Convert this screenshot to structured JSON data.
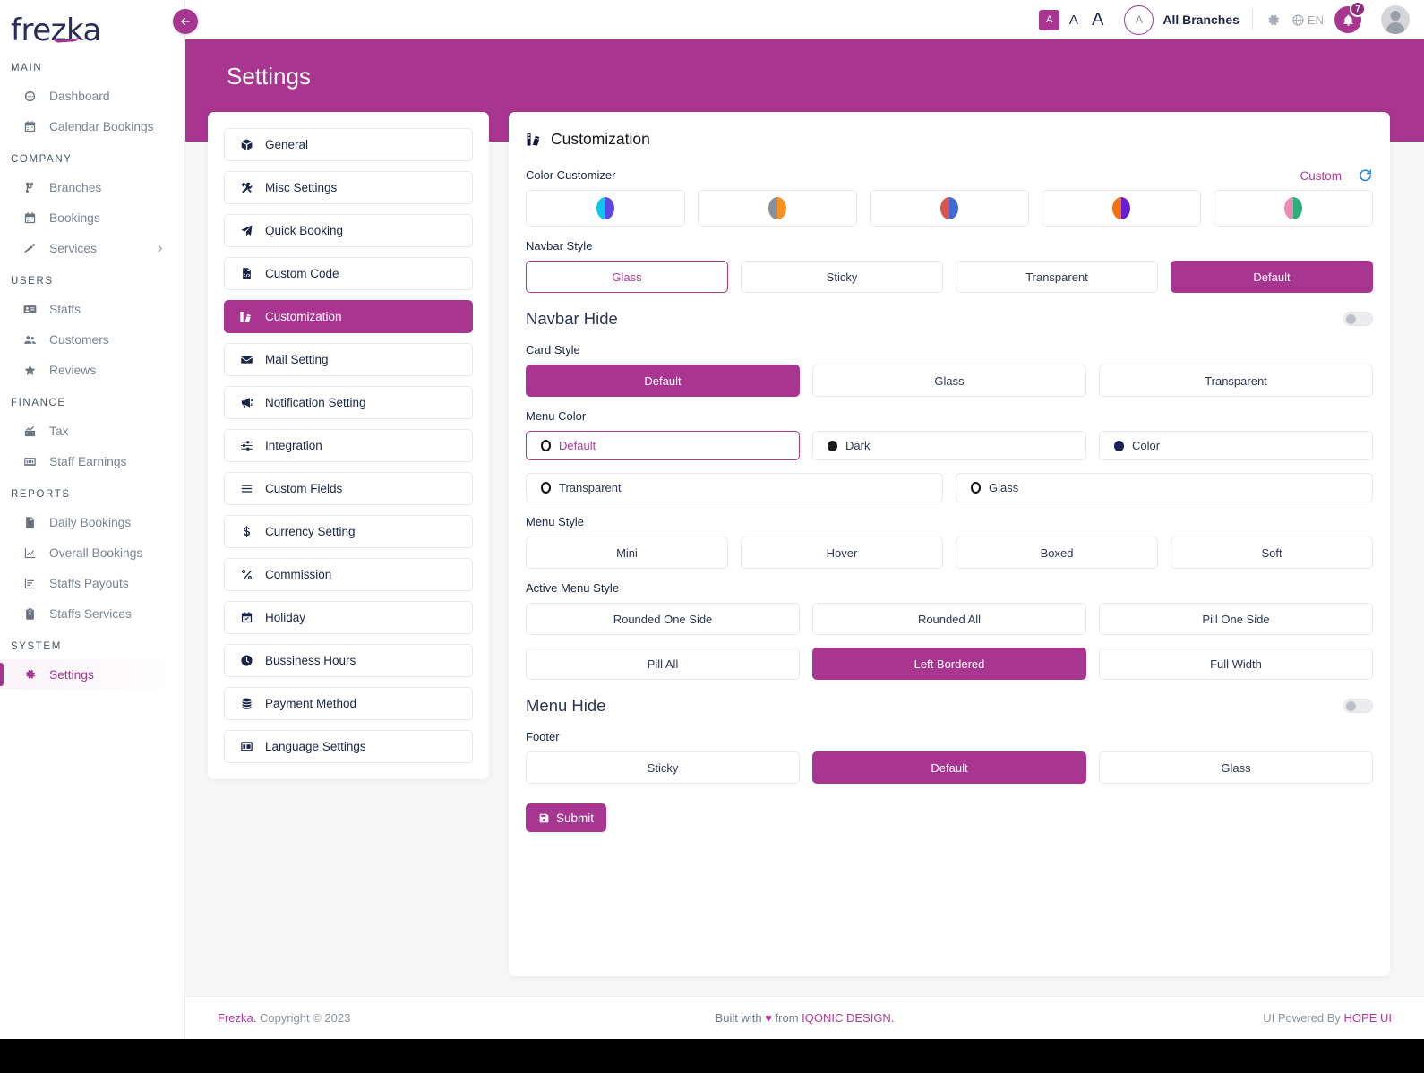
{
  "brand": {
    "name": "frezka",
    "accent": "#a8358f",
    "dark": "#1b2447"
  },
  "topbar": {
    "font_sizes": [
      {
        "label": "A",
        "selected": true
      },
      {
        "label": "A",
        "selected": false
      },
      {
        "label": "A",
        "selected": false
      }
    ],
    "branch_initial": "A",
    "branch_label": "All Branches",
    "lang": "EN",
    "notification_count": "7"
  },
  "sidebar": {
    "sections": [
      {
        "title": "MAIN",
        "items": [
          {
            "label": "Dashboard",
            "icon": "dashboard-icon",
            "active": false
          },
          {
            "label": "Calendar Bookings",
            "icon": "calendar-icon",
            "active": false
          }
        ]
      },
      {
        "title": "COMPANY",
        "items": [
          {
            "label": "Branches",
            "icon": "branch-tree-icon",
            "active": false
          },
          {
            "label": "Bookings",
            "icon": "calendar-icon",
            "active": false
          },
          {
            "label": "Services",
            "icon": "services-icon",
            "active": false,
            "chevron": true
          }
        ]
      },
      {
        "title": "USERS",
        "items": [
          {
            "label": "Staffs",
            "icon": "id-card-icon",
            "active": false
          },
          {
            "label": "Customers",
            "icon": "users-icon",
            "active": false
          },
          {
            "label": "Reviews",
            "icon": "star-icon",
            "active": false
          }
        ]
      },
      {
        "title": "FINANCE",
        "items": [
          {
            "label": "Tax",
            "icon": "tax-chart-icon",
            "active": false
          },
          {
            "label": "Staff Earnings",
            "icon": "money-icon",
            "active": false
          }
        ]
      },
      {
        "title": "REPORTS",
        "items": [
          {
            "label": "Daily Bookings",
            "icon": "invoice-icon",
            "active": false
          },
          {
            "label": "Overall Bookings",
            "icon": "line-chart-icon",
            "active": false
          },
          {
            "label": "Staffs Payouts",
            "icon": "bar-chart-icon",
            "active": false
          },
          {
            "label": "Staffs Services",
            "icon": "clipboard-icon",
            "active": false
          }
        ]
      },
      {
        "title": "SYSTEM",
        "items": [
          {
            "label": "Settings",
            "icon": "gear-icon",
            "active": true
          }
        ]
      }
    ]
  },
  "page": {
    "title": "Settings"
  },
  "settings_tabs": [
    {
      "label": "General",
      "icon": "box-icon",
      "active": false
    },
    {
      "label": "Misc Settings",
      "icon": "tools-icon",
      "active": false
    },
    {
      "label": "Quick Booking",
      "icon": "paper-plane-icon",
      "active": false
    },
    {
      "label": "Custom Code",
      "icon": "code-file-icon",
      "active": false
    },
    {
      "label": "Customization",
      "icon": "palette-icon",
      "active": true
    },
    {
      "label": "Mail Setting",
      "icon": "envelope-icon",
      "active": false
    },
    {
      "label": "Notification Setting",
      "icon": "megaphone-icon",
      "active": false
    },
    {
      "label": "Integration",
      "icon": "sliders-icon",
      "active": false
    },
    {
      "label": "Custom Fields",
      "icon": "list-icon",
      "active": false
    },
    {
      "label": "Currency Setting",
      "icon": "dollar-icon",
      "active": false
    },
    {
      "label": "Commission",
      "icon": "percent-icon",
      "active": false
    },
    {
      "label": "Holiday",
      "icon": "calendar-check-icon",
      "active": false
    },
    {
      "label": "Bussiness Hours",
      "icon": "clock-icon",
      "active": false
    },
    {
      "label": "Payment Method",
      "icon": "coins-icon",
      "active": false
    },
    {
      "label": "Language Settings",
      "icon": "language-card-icon",
      "active": false
    }
  ],
  "customization": {
    "title": "Customization",
    "color_customizer": {
      "label": "Color Customizer",
      "custom_link": "Custom",
      "swatches": [
        {
          "left": "#10c5ed",
          "right": "#5f46e8"
        },
        {
          "left": "#8b8f99",
          "right": "#f7921e"
        },
        {
          "left": "#d9534f",
          "right": "#3f6ad8"
        },
        {
          "left": "#f2700d",
          "right": "#6a1fd6"
        },
        {
          "left": "#eb8cb5",
          "right": "#2cb07a"
        }
      ]
    },
    "navbar_style": {
      "label": "Navbar Style",
      "options": [
        {
          "label": "Glass",
          "state": "outlined"
        },
        {
          "label": "Sticky",
          "state": "plain"
        },
        {
          "label": "Transparent",
          "state": "plain"
        },
        {
          "label": "Default",
          "state": "filled"
        }
      ]
    },
    "navbar_hide": {
      "label": "Navbar Hide",
      "on": false
    },
    "card_style": {
      "label": "Card Style",
      "options": [
        {
          "label": "Default",
          "state": "filled"
        },
        {
          "label": "Glass",
          "state": "plain"
        },
        {
          "label": "Transparent",
          "state": "plain"
        }
      ]
    },
    "menu_color": {
      "label": "Menu Color",
      "options": [
        {
          "label": "Default",
          "marker": "ring",
          "color": "#111111",
          "selected": true
        },
        {
          "label": "Dark",
          "marker": "solid",
          "color": "#1b1b1b",
          "selected": false
        },
        {
          "label": "Color",
          "marker": "solid",
          "color": "#16205a",
          "selected": false
        },
        {
          "label": "Transparent",
          "marker": "ring",
          "color": "#111111",
          "selected": false
        },
        {
          "label": "Glass",
          "marker": "ring",
          "color": "#111111",
          "selected": false
        }
      ]
    },
    "menu_style": {
      "label": "Menu Style",
      "options": [
        {
          "label": "Mini",
          "state": "plain"
        },
        {
          "label": "Hover",
          "state": "plain"
        },
        {
          "label": "Boxed",
          "state": "plain"
        },
        {
          "label": "Soft",
          "state": "plain"
        }
      ]
    },
    "active_menu_style": {
      "label": "Active Menu Style",
      "options": [
        {
          "label": "Rounded One Side",
          "state": "plain"
        },
        {
          "label": "Rounded All",
          "state": "plain"
        },
        {
          "label": "Pill One Side",
          "state": "plain"
        },
        {
          "label": "Pill All",
          "state": "plain"
        },
        {
          "label": "Left Bordered",
          "state": "filled"
        },
        {
          "label": "Full Width",
          "state": "plain"
        }
      ]
    },
    "menu_hide": {
      "label": "Menu Hide",
      "on": false
    },
    "footer_style": {
      "label": "Footer",
      "options": [
        {
          "label": "Sticky",
          "state": "plain"
        },
        {
          "label": "Default",
          "state": "filled"
        },
        {
          "label": "Glass",
          "state": "plain"
        }
      ]
    },
    "submit_label": "Submit"
  },
  "footer": {
    "left_brand": "Frezka.",
    "left_rest": " Copyright © 2023",
    "center_pre": "Built with ",
    "center_heart": "♥",
    "center_mid": " from ",
    "center_brand": "IQONIC DESIGN.",
    "right_pre": "UI Powered By ",
    "right_brand": "HOPE UI"
  }
}
